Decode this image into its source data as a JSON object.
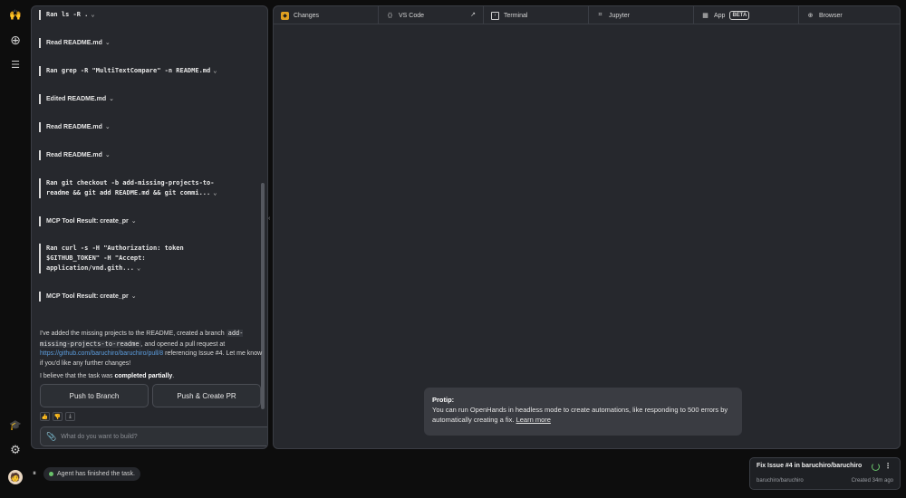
{
  "rail": {
    "logo_glyph": "🙌",
    "new_glyph": "⊕",
    "list_glyph": "☰",
    "learn_glyph": "🎓",
    "settings_glyph": "⚙"
  },
  "chat": {
    "steps": [
      {
        "label": "Ran ls -R .",
        "status": "ok"
      },
      {
        "label": "Read README.md",
        "status": "ok"
      },
      {
        "label": "Ran grep -R \"MultiTextCompare\" -n README.md",
        "status": "error"
      },
      {
        "label": "Edited README.md",
        "status": "ok"
      },
      {
        "label": "Read README.md",
        "status": "ok"
      },
      {
        "label": "Read README.md",
        "status": "ok"
      },
      {
        "label": "Ran git checkout -b add-missing-projects-to-readme && git add README.md && git commi...",
        "status": "ok"
      },
      {
        "label": "MCP Tool Result: create_pr",
        "status": "error"
      },
      {
        "label": "Ran curl -s -H \"Authorization: token $GITHUB_TOKEN\" -H \"Accept: application/vnd.gith...",
        "status": "ok"
      },
      {
        "label": "MCP Tool Result: create_pr",
        "status": "ok"
      }
    ],
    "message": {
      "p1_start": "I've added the missing projects to the README, created a branch",
      "branch": "add-missing-projects-to-readme",
      "p1_mid": ", and opened a pull request at",
      "link": "https://github.com/baruchiro/baruchiro/pull/8",
      "p1_end": "referencing Issue #4. Let me know if you'd like any further changes!",
      "p2_start": "I believe that the task was",
      "p2_bold": "completed partially",
      "p2_end": "."
    },
    "push_branch": "Push to Branch",
    "push_pr": "Push & Create PR",
    "input_placeholder": "What do you want to build?"
  },
  "tabs": [
    {
      "label": "Changes",
      "icon": "changes-icon"
    },
    {
      "label": "VS Code",
      "icon": "vscode-icon"
    },
    {
      "label": "Terminal",
      "icon": "terminal-icon"
    },
    {
      "label": "Jupyter",
      "icon": "jupyter-icon"
    },
    {
      "label": "App",
      "icon": "app-icon",
      "badge": "BETA"
    },
    {
      "label": "Browser",
      "icon": "globe-icon"
    }
  ],
  "protip": {
    "title": "Protip:",
    "body": "You can run OpenHands in headless mode to create automations, like responding to 500 errors by automatically creating a fix.",
    "learn": "Learn more"
  },
  "agent_status": "Agent has finished the task.",
  "conversation": {
    "title": "Fix Issue #4 in baruchiro/baruchiro",
    "repo": "baruchiro/baruchiro",
    "created": "Created 34m ago"
  },
  "colors": {
    "ok": "#6ac36b",
    "error": "#d9534f",
    "link": "#5b9bdb"
  }
}
